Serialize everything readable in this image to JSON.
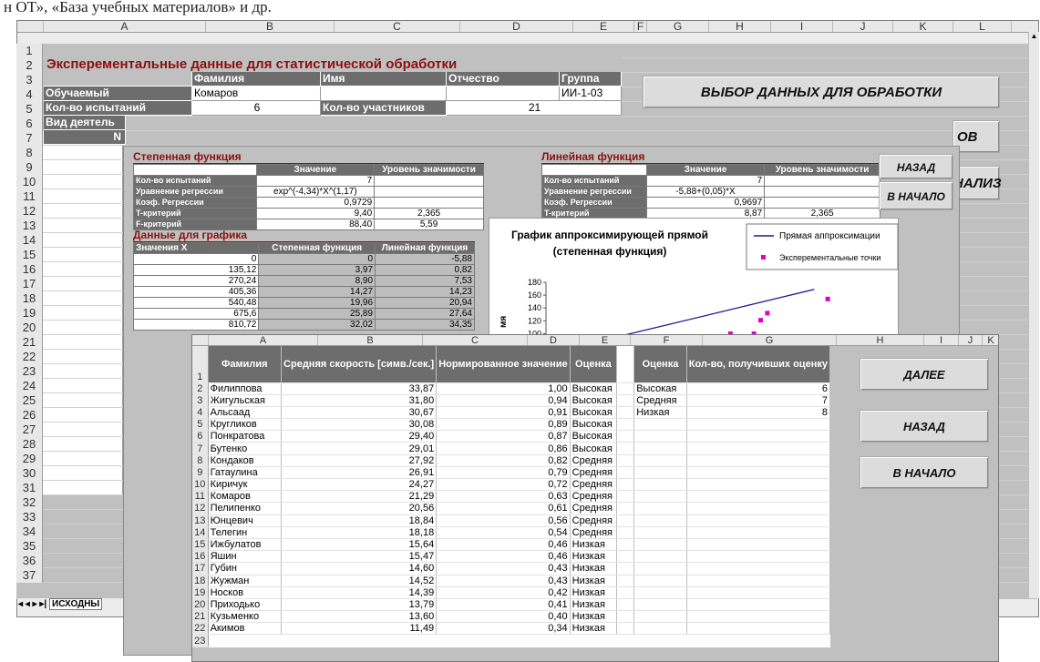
{
  "doc_top_text": "н ОТ», «База учебных материалов» и др.",
  "sheet1": {
    "columns": [
      "A",
      "B",
      "C",
      "D",
      "E",
      "F",
      "G",
      "H",
      "I",
      "J",
      "K",
      "L"
    ],
    "rows": [
      "1",
      "2",
      "3",
      "4",
      "5",
      "6",
      "7",
      "8",
      "9",
      "10",
      "11",
      "12",
      "13",
      "14",
      "15",
      "16",
      "17",
      "18",
      "19",
      "20",
      "21",
      "22",
      "23",
      "24",
      "25",
      "26",
      "27",
      "28",
      "29",
      "30",
      "31",
      "32",
      "33",
      "34",
      "35",
      "36",
      "37"
    ],
    "title": "Эксперементальные данные для статистической обработки",
    "hdr_surname": "Фамилия",
    "hdr_name": "Имя",
    "hdr_patronymic": "Отчество",
    "hdr_group": "Группа",
    "lbl_learner": "Обучаемый",
    "surname": "Комаров",
    "group": "ИИ-1-03",
    "lbl_trials": "Кол-во испытаний",
    "trials": "6",
    "lbl_participants": "Кол-во участников",
    "participants": "21",
    "lbl_activity": "Вид деятель",
    "row6_n": "N",
    "btn_select": "ВЫБОР ДАННЫХ ДЛЯ ОБРАБОТКИ",
    "btn_partial1": "ОВ",
    "btn_partial2": "НАЛИЗ",
    "sheet_tab": "ИСХОДНЫ"
  },
  "window2": {
    "power": {
      "title": "Степенная функция",
      "col_value": "Значение",
      "col_level": "Уровень значимости",
      "rows": [
        {
          "label": "Кол-во испытаний",
          "value": "7",
          "level": ""
        },
        {
          "label": "Уравнение регрессии",
          "value": "exp^(-4,34)*X^(1,17)",
          "level": ""
        },
        {
          "label": "Коэф. Регрессии",
          "value": "0,9729",
          "level": ""
        },
        {
          "label": "T-критерий",
          "value": "9,40",
          "level": "2,365"
        },
        {
          "label": "F-критерий",
          "value": "88,40",
          "level": "5,59"
        }
      ]
    },
    "linear": {
      "title": "Линейная функция",
      "col_value": "Значение",
      "col_level": "Уровень значимости",
      "rows": [
        {
          "label": "Кол-во испытаний",
          "value": "7",
          "level": ""
        },
        {
          "label": "Уравнение регрессии",
          "value": "-5,88+(0,05)*X",
          "level": ""
        },
        {
          "label": "Коэф. Регрессии",
          "value": "0,9697",
          "level": ""
        },
        {
          "label": "T-критерий",
          "value": "8,87",
          "level": "2,365"
        },
        {
          "label": "F-критерий",
          "value": "78,76",
          "level": "5,59"
        }
      ]
    },
    "graph_data": {
      "title": "Данные для графика",
      "col_x": "Значения X",
      "col_power": "Степенная функция",
      "col_linear": "Линейная функция",
      "rows": [
        {
          "x": "0",
          "p": "0",
          "l": "-5,88"
        },
        {
          "x": "135,12",
          "p": "3,97",
          "l": "0,82"
        },
        {
          "x": "270,24",
          "p": "8,90",
          "l": "7,53"
        },
        {
          "x": "405,36",
          "p": "14,27",
          "l": "14,23"
        },
        {
          "x": "540,48",
          "p": "19,96",
          "l": "20,94"
        },
        {
          "x": "675,6",
          "p": "25,89",
          "l": "27,64"
        },
        {
          "x": "810,72",
          "p": "32,02",
          "l": "34,35"
        }
      ]
    },
    "btn_back": "НАЗАД",
    "btn_start": "В НАЧАЛО"
  },
  "chart_data": {
    "type": "scatter",
    "title": "График аппроксимирующей прямой\n(степенная функция)",
    "legend": [
      "Прямая аппроксимации",
      "Эксперементальные точки"
    ],
    "legend_position": "top-right",
    "ylabel": "мя",
    "yticks": [
      "180",
      "160",
      "140",
      "120",
      "100"
    ],
    "ylim": [
      95,
      180
    ],
    "series": [
      {
        "name": "Прямая аппроксимации",
        "kind": "line",
        "x": [
          0.22,
          0.8
        ],
        "y": [
          96,
          169
        ],
        "color": "#1a1a8c"
      },
      {
        "name": "Эксперементальные точки",
        "kind": "points",
        "x": [
          0.55,
          0.62,
          0.64,
          0.66,
          0.84
        ],
        "y": [
          100,
          100,
          121,
          132,
          154
        ],
        "color": "#e000c8"
      }
    ]
  },
  "window3": {
    "columns": [
      "A",
      "B",
      "C",
      "D",
      "E",
      "F",
      "G",
      "H",
      "I",
      "J",
      "K"
    ],
    "hdr_surname": "Фамилия",
    "hdr_speed": "Средняя скорость [симв./сек.]",
    "hdr_norm": "Нормированное значение",
    "hdr_grade": "Оценка",
    "hdr_grade2": "Оценка",
    "hdr_count": "Кол-во, получивших оценку",
    "rows": [
      {
        "n": "2",
        "name": "Филиппова",
        "speed": "33,87",
        "norm": "1,00",
        "grade": "Высокая"
      },
      {
        "n": "3",
        "name": "Жигульская",
        "speed": "31,80",
        "norm": "0,94",
        "grade": "Высокая"
      },
      {
        "n": "4",
        "name": "Альсаад",
        "speed": "30,67",
        "norm": "0,91",
        "grade": "Высокая"
      },
      {
        "n": "5",
        "name": "Кругликов",
        "speed": "30,08",
        "norm": "0,89",
        "grade": "Высокая"
      },
      {
        "n": "6",
        "name": "Понкратова",
        "speed": "29,40",
        "norm": "0,87",
        "grade": "Высокая"
      },
      {
        "n": "7",
        "name": "Бутенко",
        "speed": "29,01",
        "norm": "0,86",
        "grade": "Высокая"
      },
      {
        "n": "8",
        "name": "Кондаков",
        "speed": "27,92",
        "norm": "0,82",
        "grade": "Средняя"
      },
      {
        "n": "9",
        "name": "Гатаулина",
        "speed": "26,91",
        "norm": "0,79",
        "grade": "Средняя"
      },
      {
        "n": "10",
        "name": "Киричук",
        "speed": "24,27",
        "norm": "0,72",
        "grade": "Средняя"
      },
      {
        "n": "11",
        "name": "Комаров",
        "speed": "21,29",
        "norm": "0,63",
        "grade": "Средняя"
      },
      {
        "n": "12",
        "name": "Пелипенко",
        "speed": "20,56",
        "norm": "0,61",
        "grade": "Средняя"
      },
      {
        "n": "13",
        "name": "Юнцевич",
        "speed": "18,84",
        "norm": "0,56",
        "grade": "Средняя"
      },
      {
        "n": "14",
        "name": "Телегин",
        "speed": "18,18",
        "norm": "0,54",
        "grade": "Средняя"
      },
      {
        "n": "15",
        "name": "Ижбулатов",
        "speed": "15,64",
        "norm": "0,46",
        "grade": "Низкая"
      },
      {
        "n": "16",
        "name": "Яшин",
        "speed": "15,47",
        "norm": "0,46",
        "grade": "Низкая"
      },
      {
        "n": "17",
        "name": "Губин",
        "speed": "14,60",
        "norm": "0,43",
        "grade": "Низкая"
      },
      {
        "n": "18",
        "name": "Жужман",
        "speed": "14,52",
        "norm": "0,43",
        "grade": "Низкая"
      },
      {
        "n": "19",
        "name": "Носков",
        "speed": "14,39",
        "norm": "0,42",
        "grade": "Низкая"
      },
      {
        "n": "20",
        "name": "Приходько",
        "speed": "13,79",
        "norm": "0,41",
        "grade": "Низкая"
      },
      {
        "n": "21",
        "name": "Кузьменко",
        "speed": "13,60",
        "norm": "0,40",
        "grade": "Низкая"
      },
      {
        "n": "22",
        "name": "Акимов",
        "speed": "11,49",
        "norm": "0,34",
        "grade": "Низкая"
      }
    ],
    "grades_summary": [
      {
        "grade": "Высокая",
        "count": "6"
      },
      {
        "grade": "Средняя",
        "count": "7"
      },
      {
        "grade": "Низкая",
        "count": "8"
      }
    ],
    "btn_next": "ДАЛЕЕ",
    "btn_back": "НАЗАД",
    "btn_start": "В НАЧАЛО"
  }
}
